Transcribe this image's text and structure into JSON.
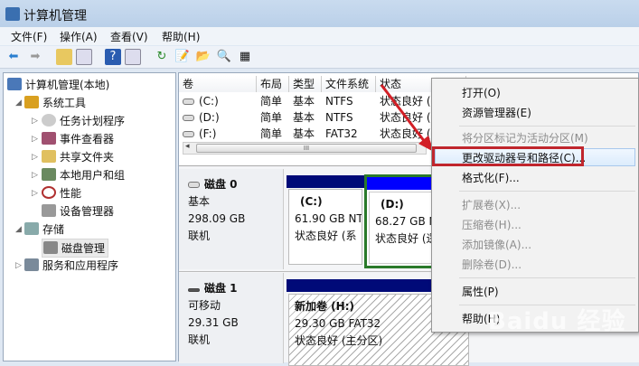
{
  "window": {
    "title": "计算机管理"
  },
  "menubar": [
    "文件(F)",
    "操作(A)",
    "查看(V)",
    "帮助(H)"
  ],
  "toolbar": [
    "back-icon",
    "forward-icon",
    "up-icon",
    "show-hide-tree-icon",
    "help-icon",
    "show-action-pane-icon",
    "refresh-icon",
    "properties-icon",
    "open-icon",
    "search-icon",
    "export-icon"
  ],
  "tree": {
    "root": "计算机管理(本地)",
    "system_tools": "系统工具",
    "task_scheduler": "任务计划程序",
    "event_viewer": "事件查看器",
    "shared_folders": "共享文件夹",
    "local_users": "本地用户和组",
    "performance": "性能",
    "device_manager": "设备管理器",
    "storage": "存储",
    "disk_management": "磁盘管理",
    "services": "服务和应用程序"
  },
  "table": {
    "headers": [
      "卷",
      "布局",
      "类型",
      "文件系统",
      "状态"
    ],
    "rows": [
      [
        "(C:)",
        "简单",
        "基本",
        "NTFS",
        "状态良好 ("
      ],
      [
        "(D:)",
        "简单",
        "基本",
        "NTFS",
        "状态良好 ("
      ],
      [
        "(F:)",
        "简单",
        "基本",
        "FAT32",
        "状态良好 ("
      ]
    ],
    "scroll_grip": "III"
  },
  "disks": [
    {
      "name": "磁盘 0",
      "type": "基本",
      "size": "298.09 GB",
      "status": "联机",
      "partitions": [
        {
          "label": "(C:)",
          "size": "61.90 GB NT",
          "status": "状态良好 (系"
        },
        {
          "label": "(D:)",
          "size": "68.27 GB N",
          "status": "状态良好 (逻"
        }
      ]
    },
    {
      "name": "磁盘 1",
      "type": "可移动",
      "size": "29.31 GB",
      "status": "联机",
      "partitions": [
        {
          "label": "新加卷  (H:)",
          "size": "29.30 GB FAT32",
          "status": "状态良好 (主分区)"
        }
      ]
    }
  ],
  "context_menu": [
    {
      "label": "打开(O)",
      "enabled": true
    },
    {
      "label": "资源管理器(E)",
      "enabled": true
    },
    {
      "label": "将分区标记为活动分区(M)",
      "enabled": false
    },
    {
      "label": "更改驱动器号和路径(C)...",
      "enabled": true,
      "highlighted": true
    },
    {
      "label": "格式化(F)...",
      "enabled": true
    },
    {
      "label": "扩展卷(X)...",
      "enabled": false
    },
    {
      "label": "压缩卷(H)...",
      "enabled": false
    },
    {
      "label": "添加镜像(A)...",
      "enabled": false
    },
    {
      "label": "删除卷(D)...",
      "enabled": false
    },
    {
      "label": "属性(P)",
      "enabled": true
    },
    {
      "label": "帮助(H)",
      "enabled": true
    }
  ],
  "watermark": "Baidu 经验",
  "colors": {
    "primary_bar": "#000a78",
    "logical_bar": "#0000ff",
    "selected_border": "#2a7a2a",
    "annotation_red": "#c0262d"
  }
}
